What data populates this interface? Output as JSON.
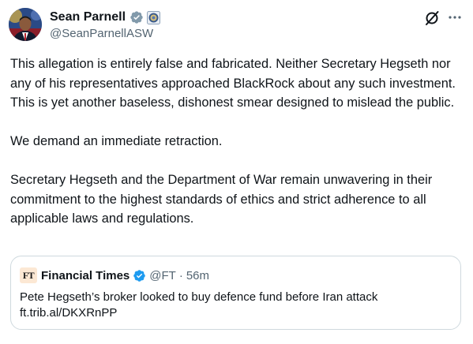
{
  "author": {
    "display_name": "Sean Parnell",
    "handle": "@SeanParnellASW",
    "verified": true,
    "verified_color": "#1d9bf0",
    "affiliate_badge": "dod-seal-icon"
  },
  "actions": {
    "grok_icon": "grok-icon",
    "more_icon": "more-icon"
  },
  "body": {
    "paragraphs": [
      "This allegation is entirely false and fabricated. Neither Secretary Hegseth nor any of his representatives approached BlackRock about any such investment. This is yet another baseless, dishonest smear designed to mislead the public.",
      "We demand an immediate retraction.",
      "Secretary Hegseth and the Department of War remain unwavering in their commitment to the highest standards of ethics and strict adherence to all applicable laws and regulations."
    ]
  },
  "quoted_post": {
    "logo_text": "FT",
    "logo_bg": "#fce8d4",
    "display_name": "Financial Times",
    "verified": true,
    "handle": "@FT",
    "separator": "·",
    "time": "56m",
    "text": "Pete Hegseth’s broker looked to buy defence fund before Iran attack",
    "link": "ft.trib.al/DKXRnPP"
  },
  "colors": {
    "text_primary": "#0f1419",
    "text_secondary": "#536471",
    "border": "#cfd9de",
    "verified_blue": "#1d9bf0"
  }
}
